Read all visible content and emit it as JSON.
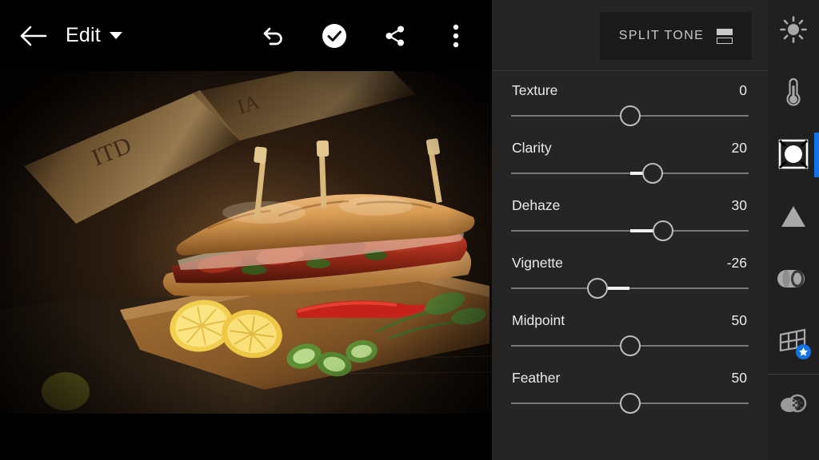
{
  "topbar": {
    "back_icon": "back-arrow-icon",
    "title": "Edit",
    "dropdown_icon": "chevron-down-icon",
    "undo_icon": "undo-icon",
    "confirm_icon": "check-circle-icon",
    "share_icon": "share-icon",
    "more_icon": "overflow-menu-icon"
  },
  "photo": {
    "description": "Dark moody food photograph of a submarine sandwich on a wooden cutting board with lemon slices, red chili, cucumber and herbs"
  },
  "panel": {
    "section_button": {
      "label": "SPLIT TONE",
      "icon": "split-tone-icon"
    },
    "sliders": [
      {
        "label": "Texture",
        "value": "0",
        "position": 50.0,
        "origin": 50
      },
      {
        "label": "Clarity",
        "value": "20",
        "position": 59.5,
        "origin": 50
      },
      {
        "label": "Dehaze",
        "value": "30",
        "position": 64.0,
        "origin": 50
      },
      {
        "label": "Vignette",
        "value": "-26",
        "position": 36.5,
        "origin": 50
      },
      {
        "label": "Midpoint",
        "value": "50",
        "position": 50.0,
        "origin": 50
      },
      {
        "label": "Feather",
        "value": "50",
        "position": 50.0,
        "origin": 50
      }
    ]
  },
  "rail": {
    "items": [
      {
        "name": "light-tool",
        "icon": "sun-icon",
        "active": false,
        "premium": false
      },
      {
        "name": "color-tool",
        "icon": "thermometer-icon",
        "active": false,
        "premium": false
      },
      {
        "name": "effects-tool",
        "icon": "effects-square-icon",
        "active": true,
        "premium": false
      },
      {
        "name": "detail-tool",
        "icon": "triangle-icon",
        "active": false,
        "premium": false
      },
      {
        "name": "optics-tool",
        "icon": "lens-icon",
        "active": false,
        "premium": false
      },
      {
        "name": "geometry-tool",
        "icon": "perspective-grid-icon",
        "active": false,
        "premium": true
      },
      {
        "name": "healing-tool",
        "icon": "healing-brush-icon",
        "active": false,
        "premium": false
      }
    ],
    "accent_color": "#1473E6"
  }
}
